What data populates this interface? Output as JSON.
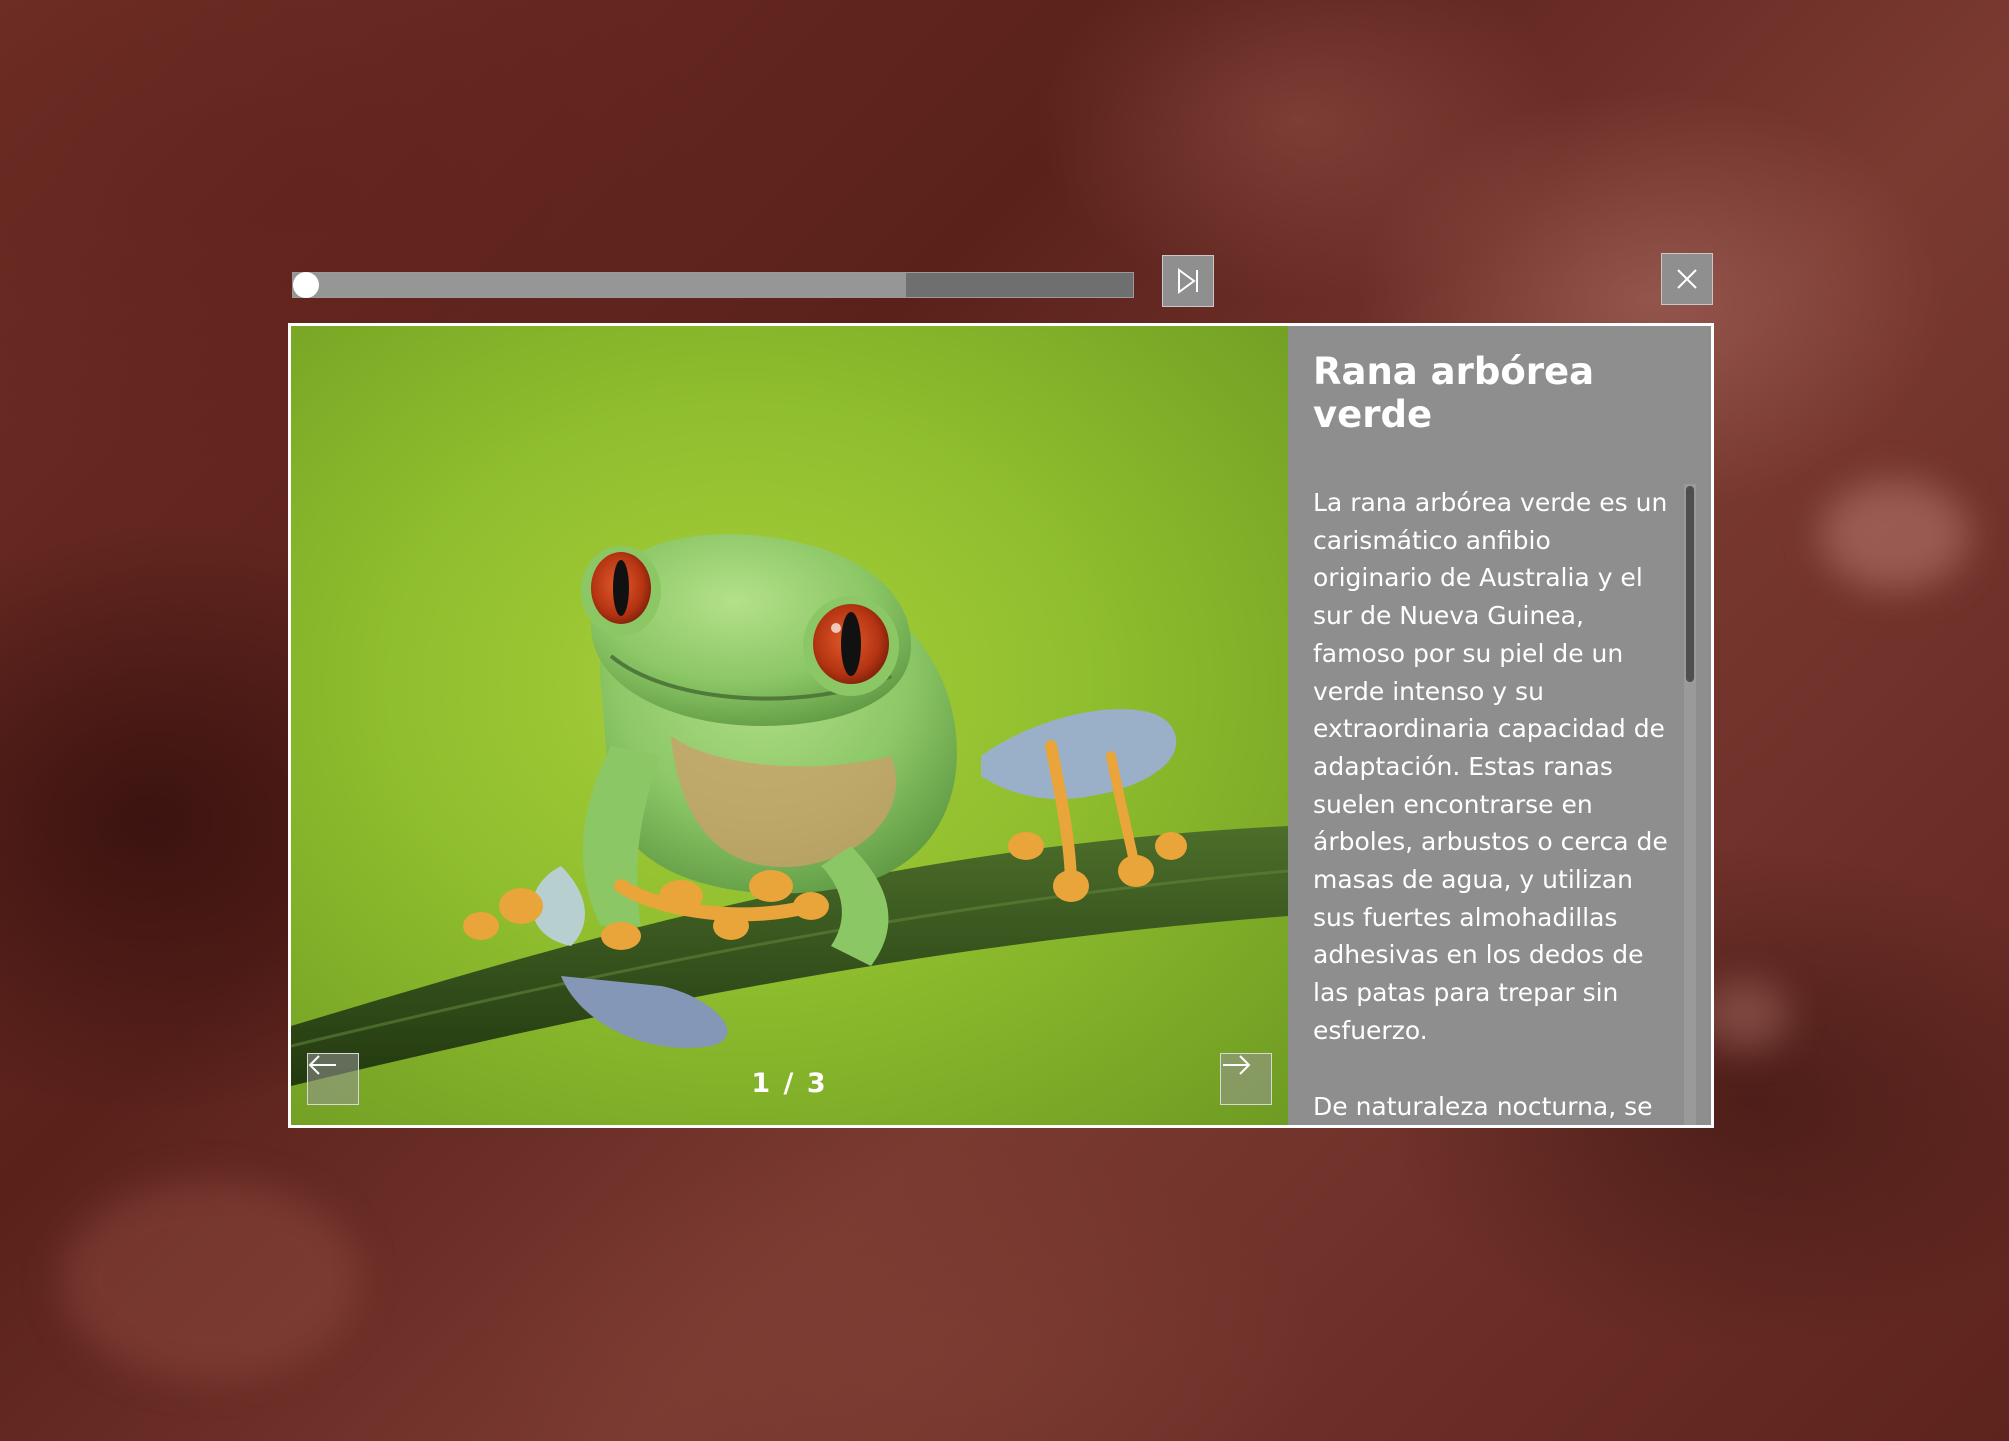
{
  "player": {
    "progress_fraction": 0.0,
    "buffered_fraction": 0.73
  },
  "controls": {
    "skip_icon": "skip-forward-icon",
    "close_icon": "close-icon"
  },
  "slide": {
    "title": "Rana arbórea verde",
    "paragraphs": [
      "La rana arbórea verde es un carismático anfibio originario de Australia y el sur de Nueva Guinea, famoso por su piel de un verde intenso y su extraordinaria capacidad de adaptación. Estas ranas suelen encontrarse en árboles, arbustos o cerca de masas de agua, y utilizan sus fuertes almohadillas adhesivas en los dedos de las patas para trepar sin esfuerzo.",
      "De naturaleza nocturna, se"
    ],
    "counter": "1 / 3",
    "prev_icon": "arrow-left-icon",
    "next_icon": "arrow-right-icon"
  },
  "colors": {
    "panel": "#8e8e8e",
    "border": "#ffffff",
    "backdrop": "#6e2d25"
  }
}
